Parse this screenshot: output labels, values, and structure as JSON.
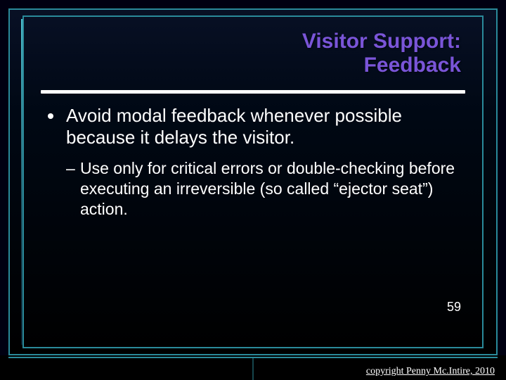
{
  "title": {
    "line1": "Visitor Support:",
    "line2": "Feedback"
  },
  "bullets": {
    "level1": "Avoid modal feedback whenever possible because it delays the visitor.",
    "level2": "Use only for critical errors or double-checking before executing an irreversible (so called “ejector seat”) action."
  },
  "page_number": "59",
  "copyright": "copyright Penny Mc.Intire, 2010"
}
